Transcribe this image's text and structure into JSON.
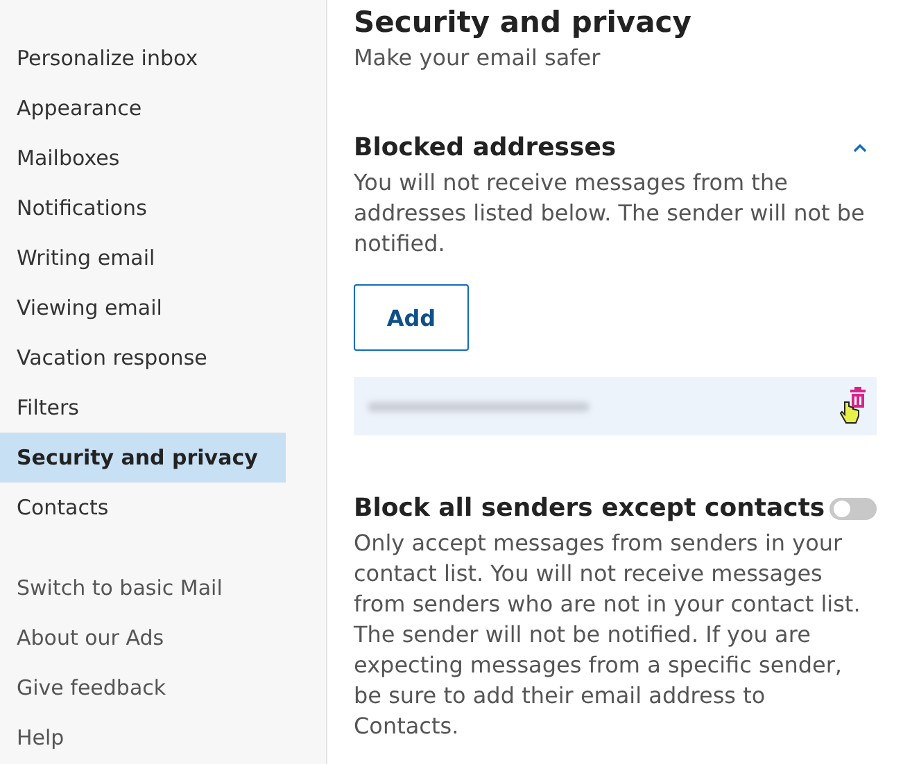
{
  "sidebar": {
    "items": [
      {
        "label": "Personalize inbox",
        "selected": false
      },
      {
        "label": "Appearance",
        "selected": false
      },
      {
        "label": "Mailboxes",
        "selected": false
      },
      {
        "label": "Notifications",
        "selected": false
      },
      {
        "label": "Writing email",
        "selected": false
      },
      {
        "label": "Viewing email",
        "selected": false
      },
      {
        "label": "Vacation response",
        "selected": false
      },
      {
        "label": "Filters",
        "selected": false
      },
      {
        "label": "Security and privacy",
        "selected": true
      },
      {
        "label": "Contacts",
        "selected": false
      }
    ],
    "footer_links": [
      "Switch to basic Mail",
      "About our Ads",
      "Give feedback",
      "Help"
    ]
  },
  "page": {
    "title": "Security and privacy",
    "subtitle": "Make your email safer"
  },
  "blocked_addresses": {
    "heading": "Blocked addresses",
    "expanded": true,
    "description": "You will not receive messages from the addresses listed below. The sender will not be notified.",
    "add_button": "Add"
  },
  "block_all": {
    "heading": "Block all senders except contacts",
    "on": false,
    "description": "Only accept messages from senders in your contact list. You will not receive messages from senders who are not in your contact list. The sender will not be notified. If you are expecting messages from a specific sender, be sure to add their email address to Contacts."
  }
}
